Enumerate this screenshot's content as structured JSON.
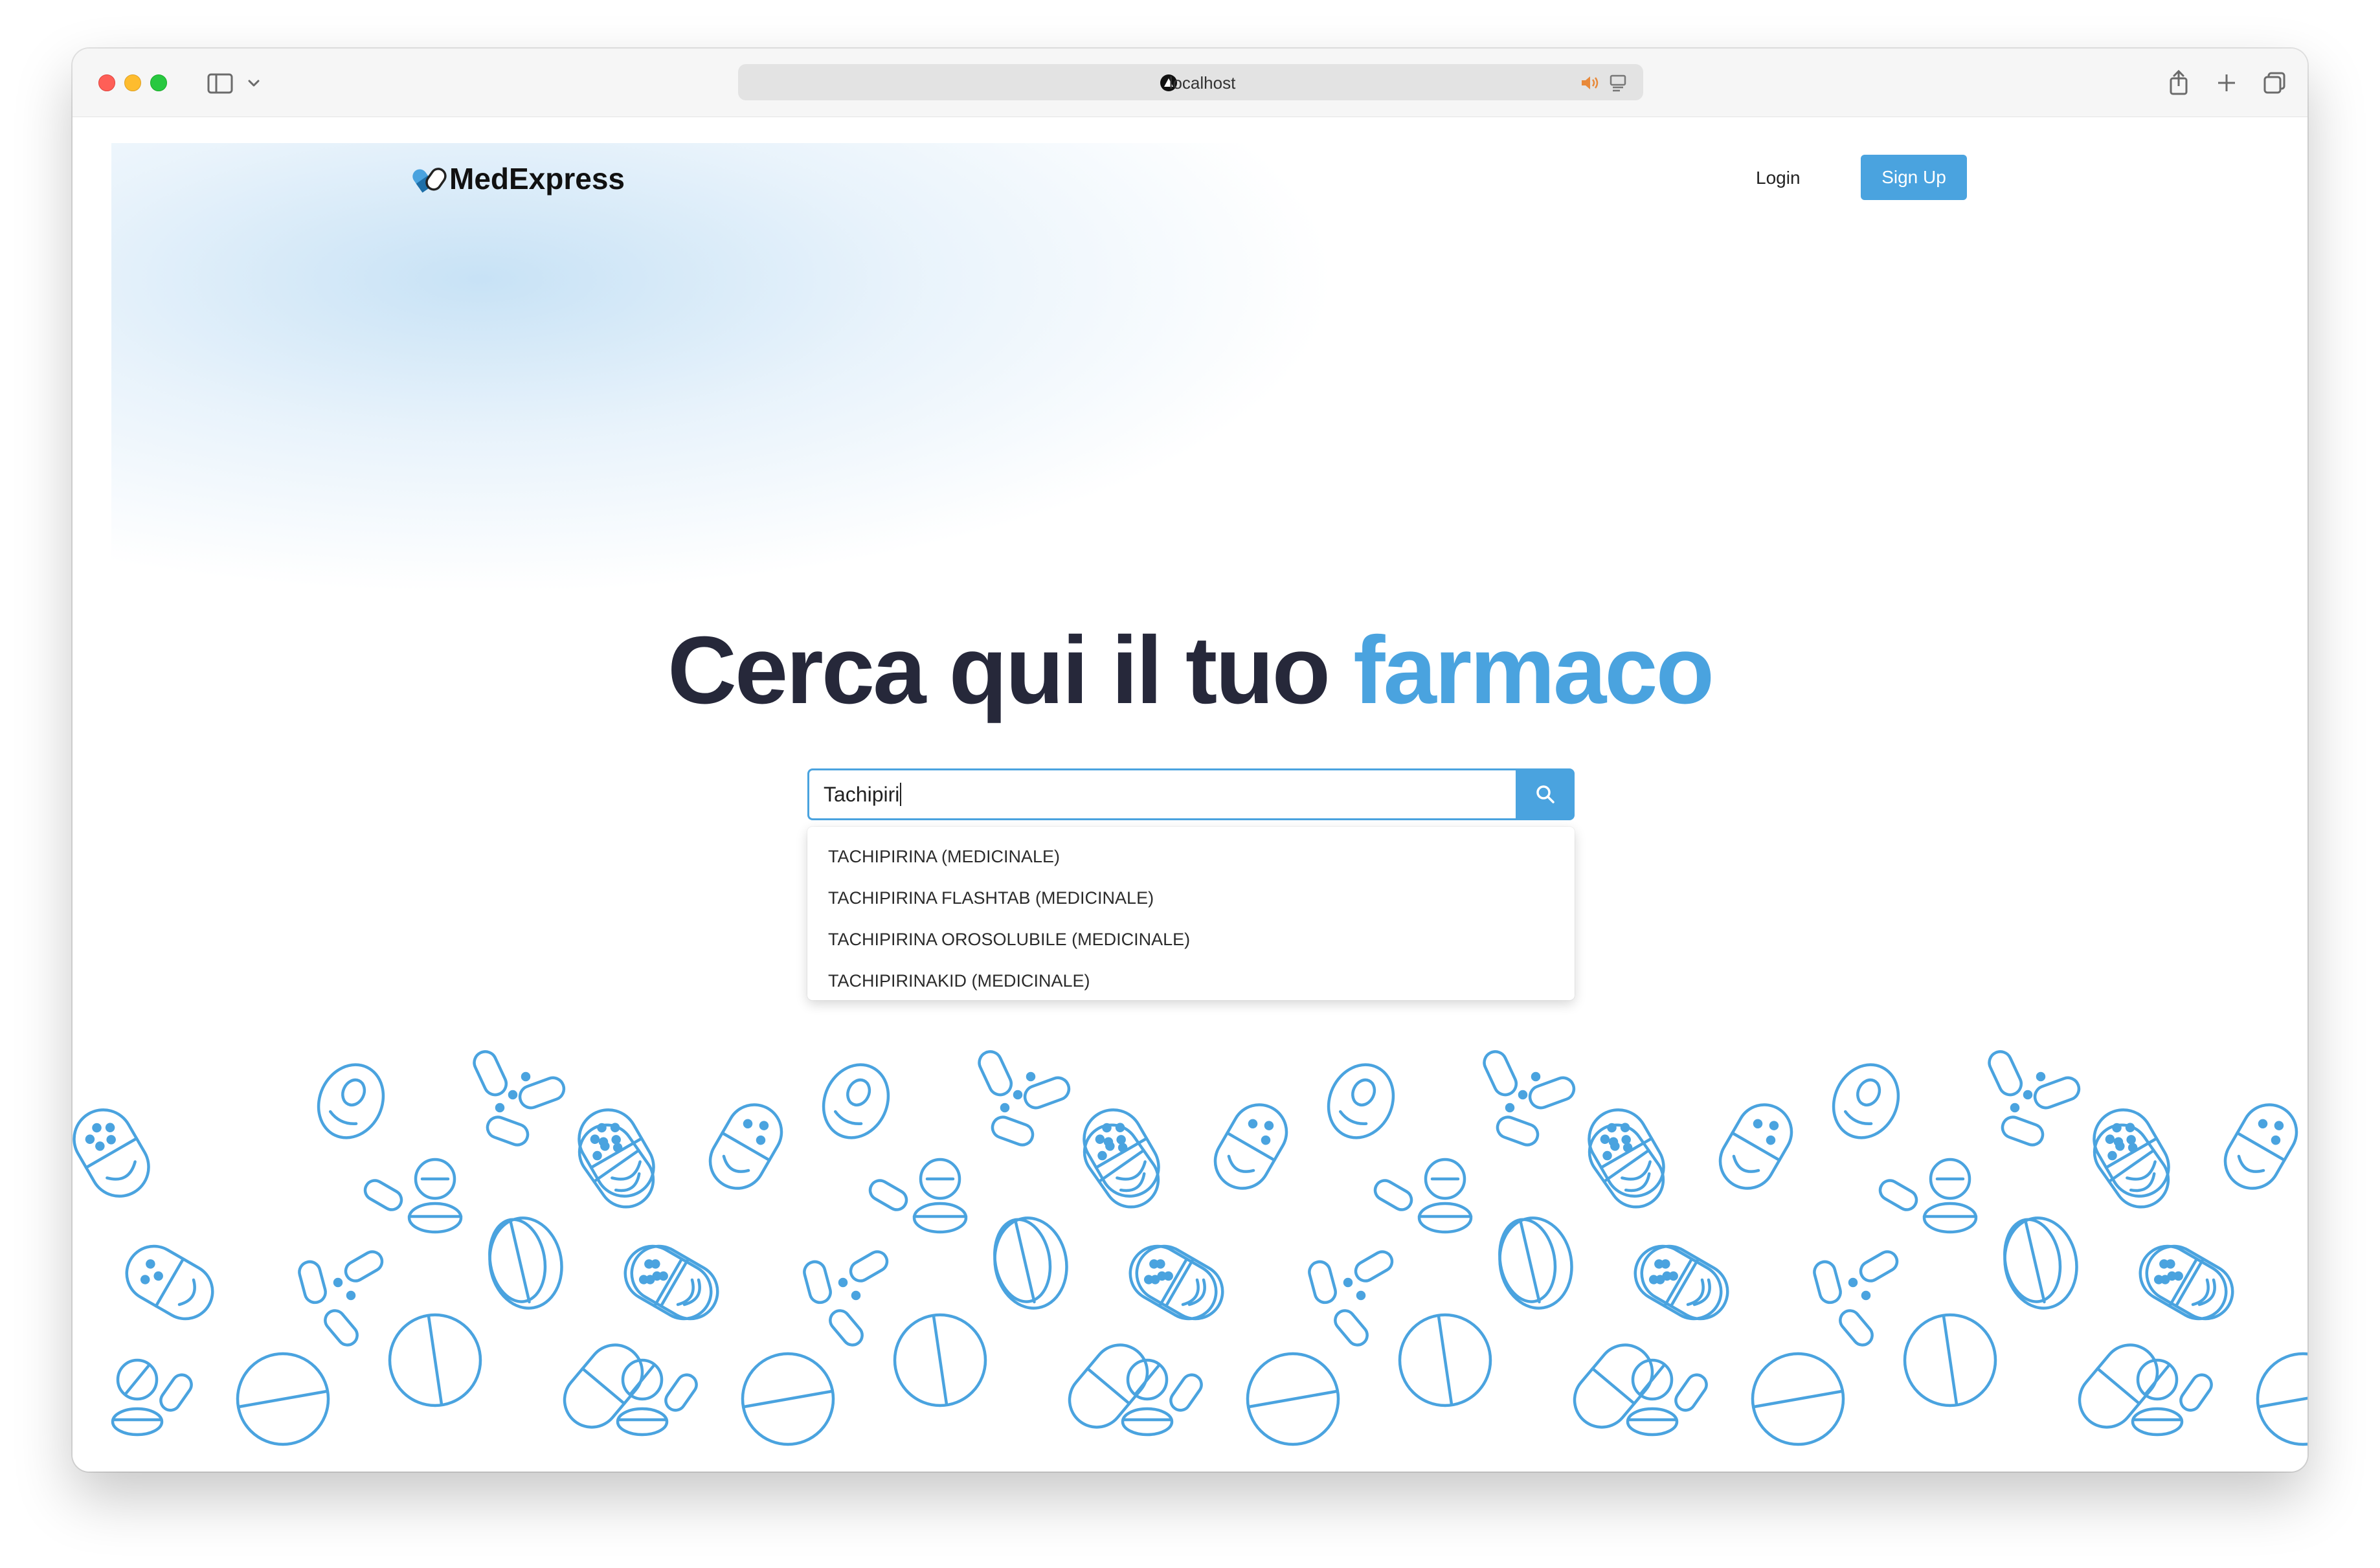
{
  "browser": {
    "url": "localhost"
  },
  "nav": {
    "logo_text": "MedExpress",
    "login_label": "Login",
    "signup_label": "Sign Up"
  },
  "hero": {
    "title_main": "Cerca qui il tuo ",
    "title_accent": "farmaco"
  },
  "search": {
    "value": "Tachipiri",
    "suggestions": [
      "TACHIPIRINA (MEDICINALE)",
      "TACHIPIRINA FLASHTAB (MEDICINALE)",
      "TACHIPIRINA OROSOLUBILE (MEDICINALE)",
      "TACHIPIRINAKID (MEDICINALE)"
    ]
  },
  "colors": {
    "accent": "#4aa3df",
    "heading": "#26283a"
  },
  "icons": {
    "logo": "pill-capsule-icon",
    "search": "search-icon",
    "background": "medicine-pattern"
  }
}
